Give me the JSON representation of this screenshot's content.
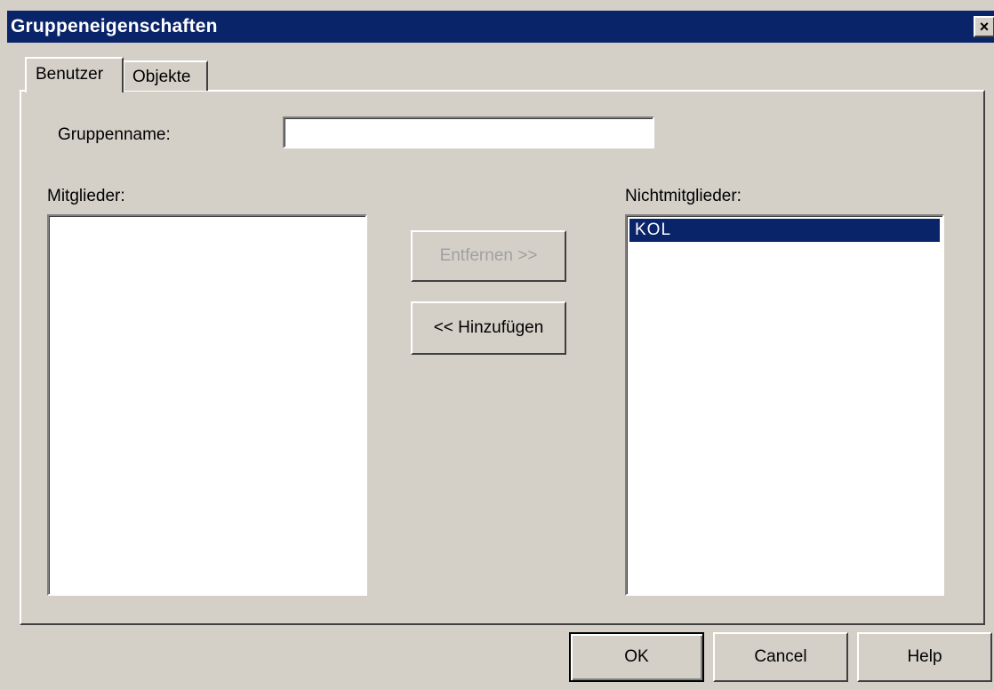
{
  "window": {
    "title": "Gruppeneigenschaften",
    "close_label": "×"
  },
  "tabs": [
    {
      "label": "Benutzer",
      "active": true
    },
    {
      "label": "Objekte",
      "active": false
    }
  ],
  "form": {
    "group_name_label": "Gruppenname:",
    "group_name_value": ""
  },
  "members": {
    "label": "Mitglieder:",
    "items": []
  },
  "nonmembers": {
    "label": "Nichtmitglieder:",
    "items": [
      {
        "label": "KOL",
        "selected": true
      }
    ]
  },
  "actions": {
    "remove_label": "Entfernen >>",
    "add_label": "<< Hinzufügen"
  },
  "footer": {
    "ok_label": "OK",
    "cancel_label": "Cancel",
    "help_label": "Help"
  },
  "colors": {
    "titlebar": "#0a246a",
    "face": "#d4d0c8",
    "selection": "#0a246a"
  }
}
